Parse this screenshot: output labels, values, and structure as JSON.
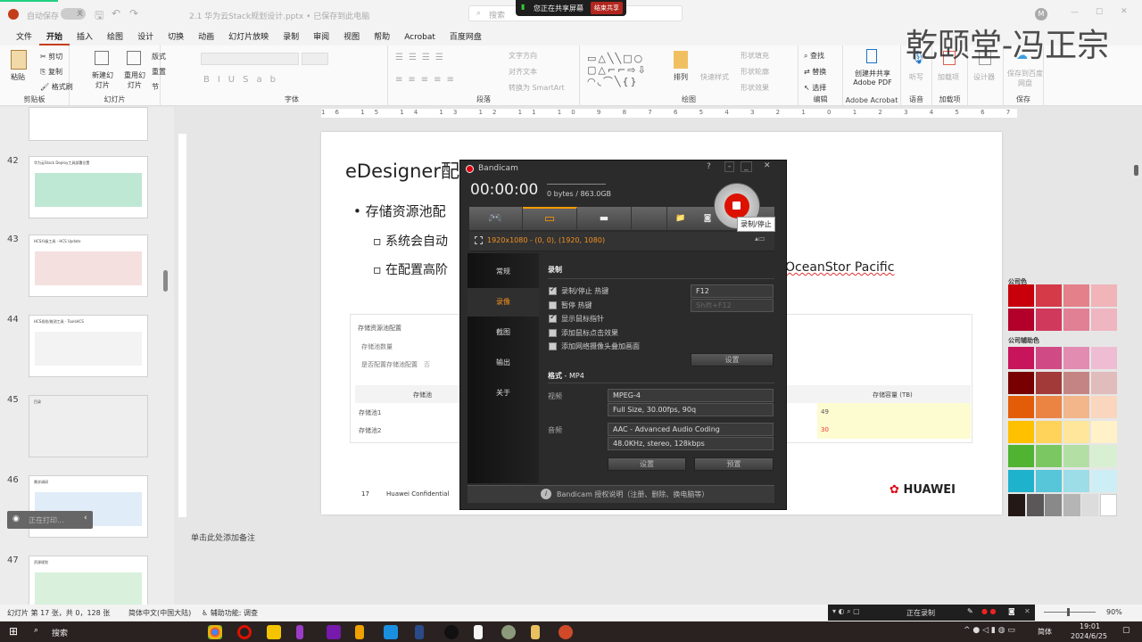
{
  "titlebar": {
    "autosave": "自动保存",
    "toggle": "关",
    "doc_title": "2.1 华为云Stack规划设计.pptx • 已保存到此电脑",
    "search_placeholder": "搜索",
    "user_initial": "M",
    "share_status": "您正在共享屏幕",
    "end_share": "结束共享"
  },
  "watermark": "乾颐堂-冯正宗",
  "menu": [
    "文件",
    "开始",
    "插入",
    "绘图",
    "设计",
    "切换",
    "动画",
    "幻灯片放映",
    "录制",
    "审阅",
    "视图",
    "帮助",
    "Acrobat",
    "百度网盘"
  ],
  "ribbon": {
    "clipboard": {
      "paste": "粘贴",
      "cut": "剪切",
      "copy": "复制",
      "format_painter": "格式刷",
      "label": "剪贴板"
    },
    "slides": {
      "new_slide": "新建幻灯片",
      "reuse": "重用幻灯片",
      "layout": "版式",
      "reset": "重置",
      "section": "节",
      "label": "幻灯片"
    },
    "font": {
      "label": "字体"
    },
    "paragraph": {
      "text_direction": "文字方向",
      "align_text": "对齐文本",
      "smartart": "转换为 SmartArt",
      "label": "段落"
    },
    "drawing": {
      "arrange": "排列",
      "quick_styles": "快速样式",
      "fill": "形状填充",
      "outline": "形状轮廓",
      "effects": "形状效果",
      "label": "绘图"
    },
    "editing": {
      "find": "查找",
      "replace": "替换",
      "select": "选择",
      "label": "编辑"
    },
    "acrobat": {
      "create": "创建并共享 Adobe PDF",
      "label": "Adobe Acrobat"
    },
    "voice": {
      "dictate": "听写",
      "label": "语音"
    },
    "addins": {
      "addins": "加载项",
      "label": "加载项"
    },
    "designer": {
      "designer": "设计器"
    },
    "save": {
      "baidu": "保存到百度网盘",
      "label": "保存"
    }
  },
  "thumbnails": [
    {
      "num": "42",
      "title": "华为云Stack Deploy工具部署位置"
    },
    {
      "num": "43",
      "title": "HCS升级工具 - HCS Update"
    },
    {
      "num": "44",
      "title": "HCS巡检/维测工具 - ToolsHCS"
    },
    {
      "num": "45",
      "title": "目录"
    },
    {
      "num": "46",
      "title": "需求调研"
    },
    {
      "num": "47",
      "title": "资源规划"
    }
  ],
  "toast": "正在打印...",
  "slide": {
    "title": "eDesigner配",
    "bullet1": "存储资源池配",
    "sub1": "系统会自动",
    "sub2": "在配置高阶",
    "sub2_tail": "OceanStor Pacific",
    "panel": {
      "section": "存储资源池配置",
      "field1": "存储池数量",
      "field2": "是否配置存储池配置",
      "field2_val": "否",
      "col1": "存储池",
      "col2": "存储容量 (TB)",
      "rows": [
        {
          "name": "存储池1",
          "cap": "49"
        },
        {
          "name": "存储池2",
          "cap": "30"
        }
      ]
    },
    "page_num": "17",
    "confidential": "Huawei Confidential",
    "logo": "HUAWEI"
  },
  "palette": {
    "title1": "公司色",
    "title2": "公司辅助色",
    "colors": [
      "#c7000b",
      "#d43a48",
      "#e38089",
      "#f0b4b9",
      "#b2002a",
      "#d0395c",
      "#e17f95",
      "#efb5c1",
      "#c7145a",
      "#d04b85",
      "#e28cb2",
      "#efbdd3",
      "#780000",
      "#a33a3a",
      "#c58484",
      "#e0bcbc",
      "#e35d09",
      "#eb8443",
      "#f3b58a",
      "#f9d6bd",
      "#ffc000",
      "#ffd25a",
      "#ffe69a",
      "#fff2c9",
      "#50b432",
      "#7bc863",
      "#b3dfa5",
      "#d9efd1",
      "#1fb2cc",
      "#57c6d9",
      "#9cdde8",
      "#cdeef4",
      "#231815",
      "#595757",
      "#898989",
      "#b5b5b5",
      "#dcdcdc",
      "#ffffff"
    ]
  },
  "notes_placeholder": "单击此处添加备注",
  "bandicam": {
    "title": "Bandicam",
    "help": "?",
    "timer": "00:00:00",
    "size": "0 bytes / 863.0GB",
    "tooltip": "录制/停止",
    "region": "1920x1080 - (0, 0), (1920, 1080)",
    "nav": [
      "常规",
      "录像",
      "截图",
      "输出",
      "关于"
    ],
    "rec_header": "录制",
    "options": [
      {
        "label": "录制/停止 热键",
        "checked": true
      },
      {
        "label": "暂停 热键",
        "checked": false
      },
      {
        "label": "显示鼠标指针",
        "checked": true
      },
      {
        "label": "添加鼠标点击效果",
        "checked": false
      },
      {
        "label": "添加网络摄像头叠加画面",
        "checked": false
      }
    ],
    "hotkey1": "F12",
    "hotkey2": "Shift+F12",
    "settings": "设置",
    "format_label": "格式",
    "format_val": " - MP4",
    "video_label": "视频",
    "video_codec": "MPEG-4",
    "video_detail": "Full Size, 30.00fps, 90q",
    "audio_label": "音频",
    "audio_codec": "AAC - Advanced Audio Coding",
    "audio_detail": "48.0KHz, stereo, 128kbps",
    "settings2": "设置",
    "presets": "预置",
    "footer": "Bandicam 授权说明（注册、删除、换电脑等）"
  },
  "statusbar": {
    "slide_info": "幻灯片 第 17 张，共 0，128 张",
    "language": "简体中文(中国大陆)",
    "accessibility": "辅助功能: 调查",
    "recording": "正在录制",
    "zoom": "90%"
  },
  "taskbar": {
    "search": "搜索",
    "time": "19:01",
    "date": "2024/6/25",
    "ime": "简体"
  }
}
